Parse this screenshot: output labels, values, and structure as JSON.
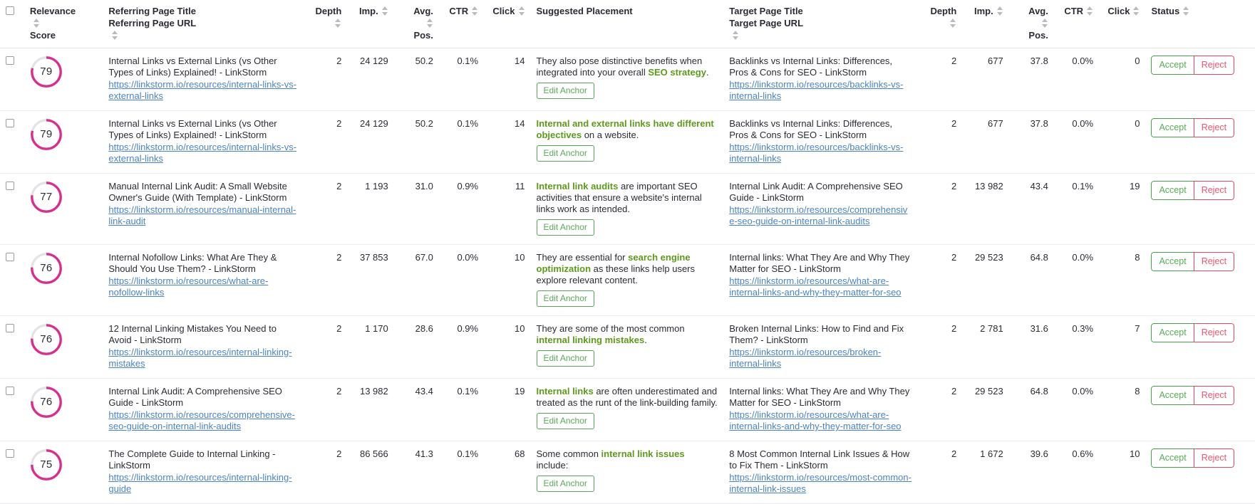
{
  "table": {
    "columns": {
      "select_all": "",
      "relevance_score": {
        "line1": "Relevance",
        "line2": "Score"
      },
      "referring": {
        "line1": "Referring Page Title",
        "line2": "Referring Page URL"
      },
      "ref_depth": "Depth",
      "ref_imp": "Imp.",
      "ref_avg_pos": {
        "line1": "Avg.",
        "line2": "Pos."
      },
      "ref_ctr": "CTR",
      "ref_click": "Click",
      "suggested_placement": "Suggested Placement",
      "target": {
        "line1": "Target Page Title",
        "line2": "Target Page URL"
      },
      "tgt_depth": "Depth",
      "tgt_imp": "Imp.",
      "tgt_avg_pos": {
        "line1": "Avg.",
        "line2": "Pos."
      },
      "tgt_ctr": "CTR",
      "tgt_click": "Click",
      "status": "Status"
    },
    "buttons": {
      "edit_anchor": "Edit Anchor",
      "accept": "Accept",
      "reject": "Reject"
    },
    "colors": {
      "score_ring": "#d62f8e",
      "score_track": "#e4e4e8",
      "anchor_highlight": "#5d9a1b",
      "link": "#4a84c4",
      "accept": "#46a24a",
      "reject": "#e0465e"
    },
    "rows": [
      {
        "score": 79,
        "referring_title": "Internal Links vs External Links (vs Other Types of Links) Explained! - LinkStorm",
        "referring_url": "https://linkstorm.io/resources/internal-links-vs-external-links",
        "ref_depth": "2",
        "ref_imp": "24 129",
        "ref_avg_pos": "50.2",
        "ref_ctr": "0.1%",
        "ref_click": "14",
        "placement_parts": [
          {
            "text": "They also pose distinctive benefits when integrated into your overall ",
            "highlight": false
          },
          {
            "text": "SEO strategy",
            "highlight": true
          },
          {
            "text": ".",
            "highlight": false
          }
        ],
        "target_title": "Backlinks vs Internal Links: Differences, Pros & Cons for SEO - LinkStorm",
        "target_url": "https://linkstorm.io/resources/backlinks-vs-internal-links",
        "tgt_depth": "2",
        "tgt_imp": "677",
        "tgt_avg_pos": "37.8",
        "tgt_ctr": "0.0%",
        "tgt_click": "0"
      },
      {
        "score": 79,
        "referring_title": "Internal Links vs External Links (vs Other Types of Links) Explained! - LinkStorm",
        "referring_url": "https://linkstorm.io/resources/internal-links-vs-external-links",
        "ref_depth": "2",
        "ref_imp": "24 129",
        "ref_avg_pos": "50.2",
        "ref_ctr": "0.1%",
        "ref_click": "14",
        "placement_parts": [
          {
            "text": "Internal and external links have different objectives",
            "highlight": true
          },
          {
            "text": " on a website.",
            "highlight": false
          }
        ],
        "target_title": "Backlinks vs Internal Links: Differences, Pros & Cons for SEO - LinkStorm",
        "target_url": "https://linkstorm.io/resources/backlinks-vs-internal-links",
        "tgt_depth": "2",
        "tgt_imp": "677",
        "tgt_avg_pos": "37.8",
        "tgt_ctr": "0.0%",
        "tgt_click": "0"
      },
      {
        "score": 77,
        "referring_title": "Manual Internal Link Audit: A Small Website Owner's Guide (With Template) - LinkStorm",
        "referring_url": "https://linkstorm.io/resources/manual-internal-link-audit",
        "ref_depth": "2",
        "ref_imp": "1 193",
        "ref_avg_pos": "31.0",
        "ref_ctr": "0.9%",
        "ref_click": "11",
        "placement_parts": [
          {
            "text": "Internal link audits",
            "highlight": true
          },
          {
            "text": " are important SEO activities that ensure a website's internal links work as intended.",
            "highlight": false
          }
        ],
        "target_title": "Internal Link Audit: A Comprehensive SEO Guide - LinkStorm",
        "target_url": "https://linkstorm.io/resources/comprehensive-seo-guide-on-internal-link-audits",
        "tgt_depth": "2",
        "tgt_imp": "13 982",
        "tgt_avg_pos": "43.4",
        "tgt_ctr": "0.1%",
        "tgt_click": "19"
      },
      {
        "score": 76,
        "referring_title": "Internal Nofollow Links: What Are They & Should You Use Them? - LinkStorm",
        "referring_url": "https://linkstorm.io/resources/what-are-nofollow-links",
        "ref_depth": "2",
        "ref_imp": "37 853",
        "ref_avg_pos": "67.0",
        "ref_ctr": "0.0%",
        "ref_click": "10",
        "placement_parts": [
          {
            "text": "They are essential for ",
            "highlight": false
          },
          {
            "text": "search engine optimization",
            "highlight": true
          },
          {
            "text": " as these links help users explore relevant content.",
            "highlight": false
          }
        ],
        "target_title": "Internal links: What They Are and Why They Matter for SEO - LinkStorm",
        "target_url": "https://linkstorm.io/resources/what-are-internal-links-and-why-they-matter-for-seo",
        "tgt_depth": "2",
        "tgt_imp": "29 523",
        "tgt_avg_pos": "64.8",
        "tgt_ctr": "0.0%",
        "tgt_click": "8"
      },
      {
        "score": 76,
        "referring_title": "12 Internal Linking Mistakes You Need to Avoid - LinkStorm",
        "referring_url": "https://linkstorm.io/resources/internal-linking-mistakes",
        "ref_depth": "2",
        "ref_imp": "1 170",
        "ref_avg_pos": "28.6",
        "ref_ctr": "0.9%",
        "ref_click": "10",
        "placement_parts": [
          {
            "text": "They are some of the most common ",
            "highlight": false
          },
          {
            "text": "internal linking mistakes",
            "highlight": true
          },
          {
            "text": ".",
            "highlight": false
          }
        ],
        "target_title": "Broken Internal Links: How to Find and Fix Them? - LinkStorm",
        "target_url": "https://linkstorm.io/resources/broken-internal-links",
        "tgt_depth": "2",
        "tgt_imp": "2 781",
        "tgt_avg_pos": "31.6",
        "tgt_ctr": "0.3%",
        "tgt_click": "7"
      },
      {
        "score": 76,
        "referring_title": "Internal Link Audit: A Comprehensive SEO Guide - LinkStorm",
        "referring_url": "https://linkstorm.io/resources/comprehensive-seo-guide-on-internal-link-audits",
        "ref_depth": "2",
        "ref_imp": "13 982",
        "ref_avg_pos": "43.4",
        "ref_ctr": "0.1%",
        "ref_click": "19",
        "placement_parts": [
          {
            "text": "Internal links",
            "highlight": true
          },
          {
            "text": " are often underestimated and treated as the runt of the link-building family.",
            "highlight": false
          }
        ],
        "target_title": "Internal links: What They Are and Why They Matter for SEO - LinkStorm",
        "target_url": "https://linkstorm.io/resources/what-are-internal-links-and-why-they-matter-for-seo",
        "tgt_depth": "2",
        "tgt_imp": "29 523",
        "tgt_avg_pos": "64.8",
        "tgt_ctr": "0.0%",
        "tgt_click": "8"
      },
      {
        "score": 75,
        "referring_title": "The Complete Guide to Internal Linking - LinkStorm",
        "referring_url": "https://linkstorm.io/resources/internal-linking-guide",
        "ref_depth": "2",
        "ref_imp": "86 566",
        "ref_avg_pos": "41.3",
        "ref_ctr": "0.1%",
        "ref_click": "68",
        "placement_parts": [
          {
            "text": "Some common ",
            "highlight": false
          },
          {
            "text": "internal link issues",
            "highlight": true
          },
          {
            "text": " include:",
            "highlight": false
          }
        ],
        "target_title": "8 Most Common Internal Link Issues & How to Fix Them - LinkStorm",
        "target_url": "https://linkstorm.io/resources/most-common-internal-link-issues",
        "tgt_depth": "2",
        "tgt_imp": "1 672",
        "tgt_avg_pos": "39.6",
        "tgt_ctr": "0.6%",
        "tgt_click": "10"
      }
    ]
  }
}
